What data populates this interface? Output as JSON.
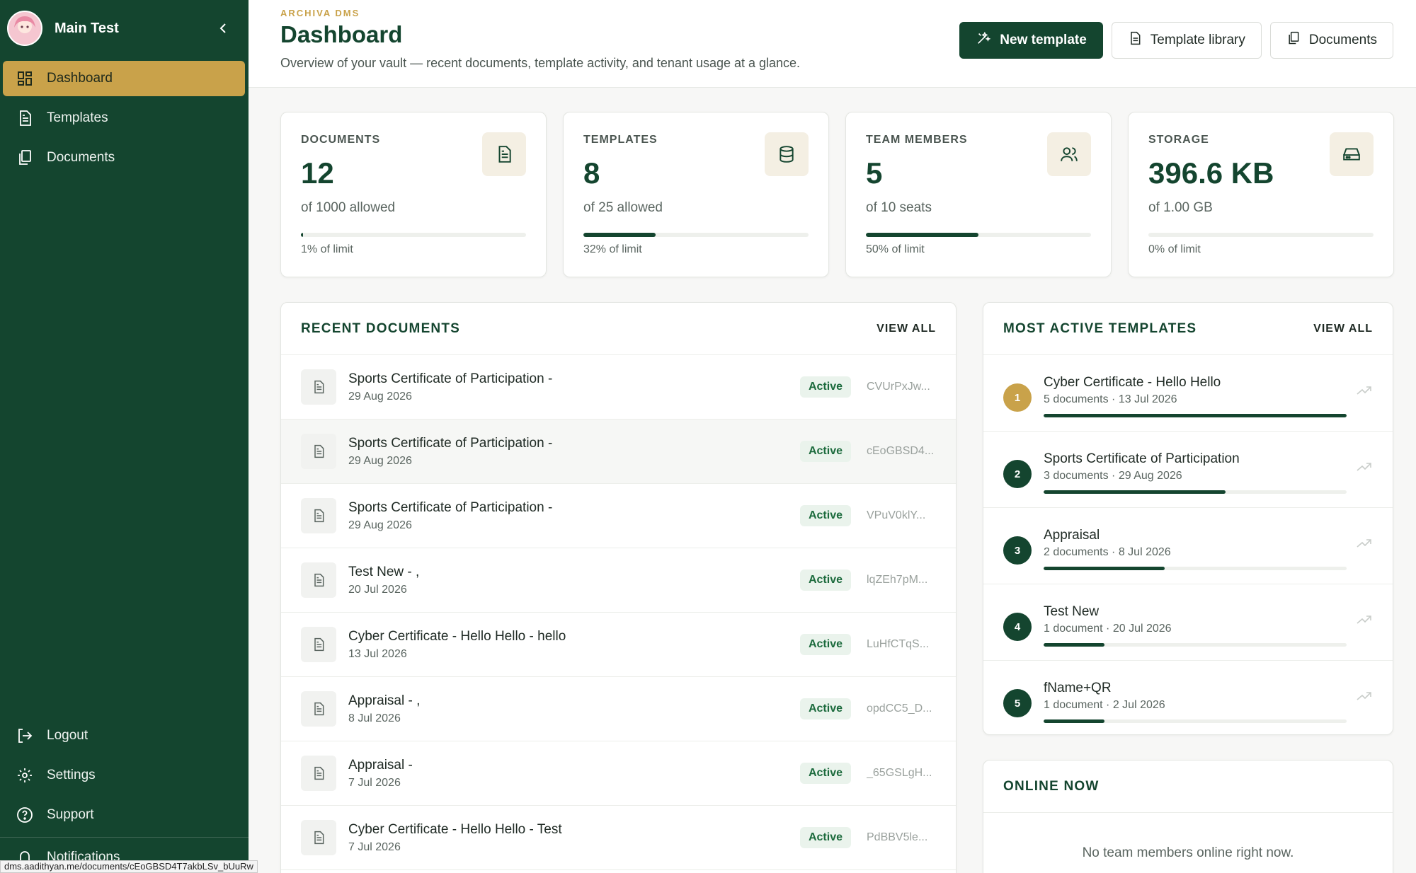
{
  "sidebar": {
    "user_name": "Main Test",
    "nav": [
      {
        "label": "Dashboard",
        "icon": "dashboard-icon",
        "active": true
      },
      {
        "label": "Templates",
        "icon": "template-icon"
      },
      {
        "label": "Documents",
        "icon": "documents-icon"
      }
    ],
    "bottom": [
      {
        "label": "Logout",
        "icon": "logout-icon"
      },
      {
        "label": "Settings",
        "icon": "gear-icon"
      },
      {
        "label": "Support",
        "icon": "help-icon"
      },
      {
        "label": "Notifications",
        "icon": "bell-icon"
      }
    ],
    "status_url": "dms.aadithyan.me/documents/cEoGBSD4T7akbLSv_bUuRw"
  },
  "header": {
    "eyebrow": "ARCHIVA DMS",
    "title": "Dashboard",
    "subtitle": "Overview of your vault — recent documents, template activity, and tenant usage at a glance.",
    "new_template": "New template",
    "template_library": "Template library",
    "documents": "Documents"
  },
  "stats": [
    {
      "label": "DOCUMENTS",
      "value": "12",
      "sub": "of 1000 allowed",
      "pct": 1,
      "foot": "1% of limit",
      "icon": "document-icon"
    },
    {
      "label": "TEMPLATES",
      "value": "8",
      "sub": "of 25 allowed",
      "pct": 32,
      "foot": "32% of limit",
      "icon": "database-icon"
    },
    {
      "label": "TEAM MEMBERS",
      "value": "5",
      "sub": "of 10 seats",
      "pct": 50,
      "foot": "50% of limit",
      "icon": "users-icon"
    },
    {
      "label": "STORAGE",
      "value": "396.6 KB",
      "sub": "of 1.00 GB",
      "pct": 0,
      "foot": "0% of limit",
      "icon": "drive-icon"
    }
  ],
  "recent": {
    "title": "RECENT DOCUMENTS",
    "view_all": "VIEW ALL",
    "rows": [
      {
        "name": "Sports Certificate of Participation -",
        "date": "29 Aug 2026",
        "status": "Active",
        "id": "CVUrPxJw..."
      },
      {
        "name": "Sports Certificate of Participation -",
        "date": "29 Aug 2026",
        "status": "Active",
        "id": "cEoGBSD4..."
      },
      {
        "name": "Sports Certificate of Participation -",
        "date": "29 Aug 2026",
        "status": "Active",
        "id": "VPuV0klY..."
      },
      {
        "name": "Test New - ,",
        "date": "20 Jul 2026",
        "status": "Active",
        "id": "lqZEh7pM..."
      },
      {
        "name": "Cyber Certificate - Hello Hello - hello",
        "date": "13 Jul 2026",
        "status": "Active",
        "id": "LuHfCTqS..."
      },
      {
        "name": "Appraisal - ,",
        "date": "8 Jul 2026",
        "status": "Active",
        "id": "opdCC5_D..."
      },
      {
        "name": "Appraisal -",
        "date": "7 Jul 2026",
        "status": "Active",
        "id": "_65GSLgH..."
      },
      {
        "name": "Cyber Certificate - Hello Hello - Test",
        "date": "7 Jul 2026",
        "status": "Active",
        "id": "PdBBV5le..."
      }
    ]
  },
  "templates": {
    "title": "MOST ACTIVE TEMPLATES",
    "view_all": "VIEW ALL",
    "rows": [
      {
        "rank": "1",
        "name": "Cyber Certificate - Hello Hello",
        "meta": "5 documents · 13 Jul 2026",
        "share": 1.0
      },
      {
        "rank": "2",
        "name": "Sports Certificate of Participation",
        "meta": "3 documents · 29 Aug 2026",
        "share": 0.6
      },
      {
        "rank": "3",
        "name": "Appraisal",
        "meta": "2 documents · 8 Jul 2026",
        "share": 0.4
      },
      {
        "rank": "4",
        "name": "Test New",
        "meta": "1 document · 20 Jul 2026",
        "share": 0.2
      },
      {
        "rank": "5",
        "name": "fName+QR",
        "meta": "1 document · 2 Jul 2026",
        "share": 0.2
      }
    ]
  },
  "online": {
    "title": "ONLINE NOW",
    "empty": "No team members online right now."
  },
  "colors": {
    "primary": "#14452f",
    "accent": "#c9a24a",
    "badge": "#1b6a3c"
  }
}
